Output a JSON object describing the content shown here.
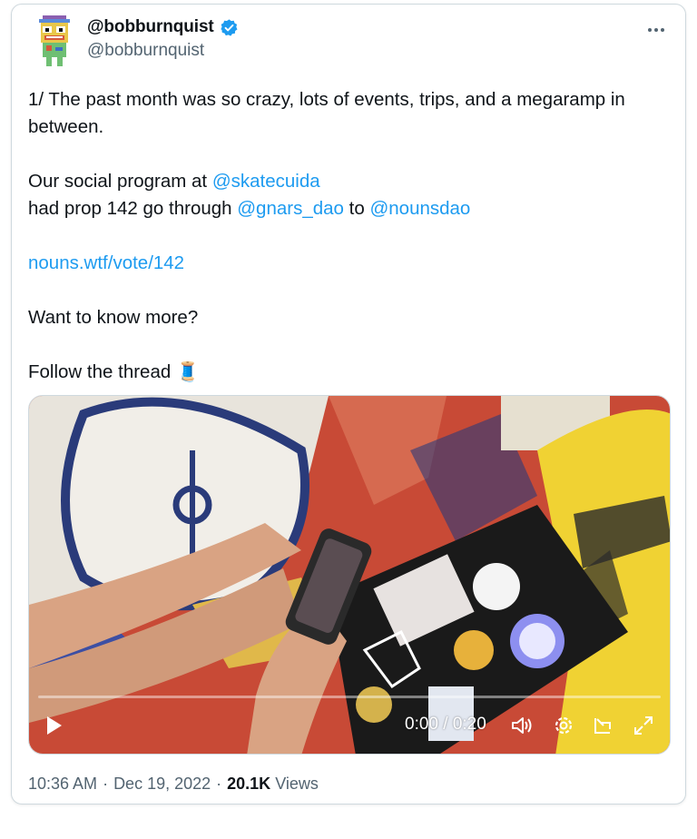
{
  "author": {
    "display_name": "@bobburnquist",
    "handle": "@bobburnquist",
    "verified": true,
    "avatar_icon": "nouns-avatar-icon"
  },
  "menu": {
    "more_icon": "more-dots-icon"
  },
  "tweet": {
    "line1": "1/  The past month was so crazy, lots of events, trips, and a megaramp in between.",
    "p2_text_a": "Our social program at ",
    "p2_mention_a": "@skatecuida",
    "p2_text_b": "had prop 142 go through ",
    "p2_mention_b": "@gnars_dao",
    "p2_text_c": " to ",
    "p2_mention_c": "@nounsdao",
    "link": "nouns.wtf/vote/142",
    "line4": "Want to know more?",
    "line5": "Follow the thread",
    "thread_emoji": "🧵"
  },
  "video": {
    "time_display": "0:00 / 0:20",
    "progress": 0,
    "icons": [
      "play-icon",
      "volume-icon",
      "settings-icon",
      "pip-icon",
      "fullscreen-icon"
    ]
  },
  "meta": {
    "time": "10:36 AM",
    "separator": "·",
    "date": "Dec 19, 2022",
    "views_count": "20.1K",
    "views_label": "Views"
  },
  "colors": {
    "link": "#1d9bf0",
    "secondary_text": "#536471",
    "verified": "#1d9bf0"
  }
}
